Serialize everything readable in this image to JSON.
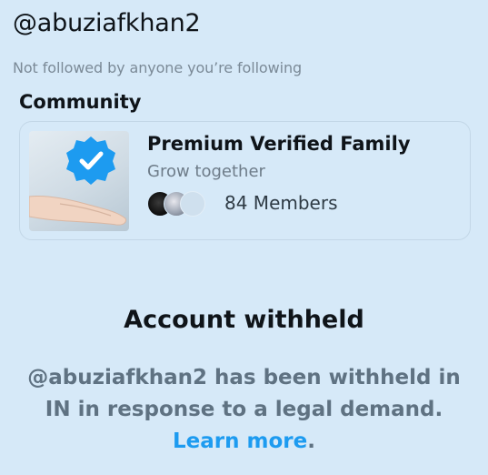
{
  "profile": {
    "handle": "@abuziafkhan2",
    "follow_note": "Not followed by anyone you’re following"
  },
  "community_section": {
    "title": "Community",
    "card": {
      "name": "Premium Verified Family",
      "tagline": "Grow together",
      "members_text": "84 Members",
      "thumbnail_icon": "verified-badge-icon",
      "badge_color": "#1d9bf0"
    }
  },
  "withheld": {
    "title": "Account withheld",
    "body": "@abuziafkhan2 has been withheld in IN in response to a legal demand.",
    "link_label": "Learn more",
    "trailing": "."
  },
  "colors": {
    "background": "#d6e9f8",
    "link": "#1d9bf0"
  }
}
